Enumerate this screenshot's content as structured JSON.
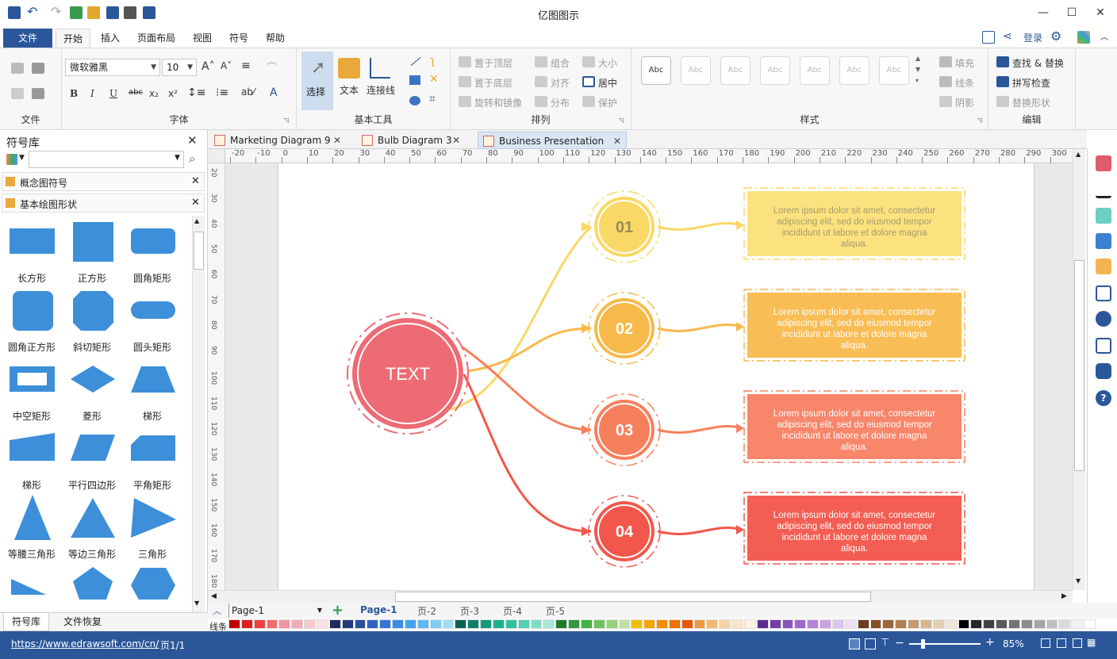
{
  "app": {
    "title": "亿图图示"
  },
  "window": {
    "minimize": "—",
    "restore": "☐",
    "close": "✕",
    "collapse": "︿",
    "help": "?"
  },
  "ribbon_tabs": [
    {
      "label": "文件"
    },
    {
      "label": "开始"
    },
    {
      "label": "插入"
    },
    {
      "label": "页面布局"
    },
    {
      "label": "视图"
    },
    {
      "label": "符号"
    },
    {
      "label": "帮助"
    }
  ],
  "account": {
    "login": "登录"
  },
  "ribbon": {
    "file_group": {
      "label": "文件"
    },
    "font_group": {
      "label": "字体",
      "font_name": "微软雅黑",
      "font_size": "10",
      "bold": "B",
      "italic": "I",
      "underline": "U",
      "strike": "abc",
      "sub": "x₂",
      "sup": "x²",
      "font_color": "A"
    },
    "tools_group": {
      "label": "基本工具",
      "select": "选择",
      "text": "文本",
      "connector": "连接线"
    },
    "arrange_group": {
      "label": "排列",
      "items": [
        "置于顶层",
        "组合",
        "大小",
        "置于底层",
        "对齐",
        "居中",
        "旋转和镜像",
        "分布",
        "保护"
      ]
    },
    "style_group": {
      "label": "样式",
      "swatch_text": "Abc",
      "fill": "填充",
      "line": "线条",
      "shadow": "阴影"
    },
    "edit_group": {
      "label": "编辑",
      "find": "查找 & 替换",
      "spell": "拼写检查",
      "replace_shape": "替换形状"
    }
  },
  "library": {
    "title": "符号库",
    "search_placeholder": "",
    "categories": [
      "概念图符号",
      "基本绘图形状"
    ],
    "shapes": [
      "长方形",
      "正方形",
      "圆角矩形",
      "圆角正方形",
      "斜切矩形",
      "圆头矩形",
      "中空矩形",
      "菱形",
      "梯形",
      "梯形",
      "平行四边形",
      "平角矩形",
      "等腰三角形",
      "等边三角形",
      "三角形"
    ],
    "bottom_tabs": [
      "符号库",
      "文件恢复"
    ]
  },
  "doc_tabs": [
    "Marketing Diagram 9",
    "Bulb Diagram 3",
    "Business Presentation"
  ],
  "ruler": {
    "h": [
      "-20",
      "-10",
      "0",
      "10",
      "20",
      "30",
      "40",
      "50",
      "60",
      "70",
      "80",
      "90",
      "100",
      "110",
      "120",
      "130",
      "140",
      "150",
      "160",
      "170",
      "180",
      "190",
      "200",
      "210",
      "220",
      "230",
      "240",
      "250",
      "260",
      "270",
      "280",
      "290",
      "300"
    ],
    "v": [
      "20",
      "30",
      "40",
      "50",
      "60",
      "70",
      "80",
      "90",
      "100",
      "110",
      "120",
      "130",
      "140",
      "150",
      "160",
      "170",
      "180"
    ]
  },
  "diagram": {
    "center_label": "TEXT",
    "items": [
      {
        "num": "01",
        "color": "#F9D866",
        "box_color": "#FCE27E",
        "text": "Lorem ipsum dolor sit amet, consectetur adipiscing elit, sed do eiusmod tempor incididunt ut labore et dolore magna aliqua."
      },
      {
        "num": "02",
        "color": "#F8B94B",
        "box_color": "#F9BD55",
        "text": "Lorem ipsum dolor sit amet, consectetur adipiscing elit, sed do eiusmod tempor incididunt ut labore et dolore magna aliqua."
      },
      {
        "num": "03",
        "color": "#F6805E",
        "box_color": "#F7866A",
        "text": "Lorem ipsum dolor sit amet, consectetur adipiscing elit, sed do eiusmod tempor incididunt ut labore et dolore magna aliqua."
      },
      {
        "num": "04",
        "color": "#F2574B",
        "box_color": "#F45D52",
        "text": "Lorem ipsum dolor sit amet, consectetur adipiscing elit, sed do eiusmod tempor incididunt ut labore et dolore magna aliqua."
      }
    ],
    "center_color": "#EC6B75"
  },
  "pages": {
    "current": "Page-1",
    "tabs": [
      "Page-1",
      "页-2",
      "页-3",
      "页-4",
      "页-5"
    ],
    "add": "+"
  },
  "colorbar": {
    "label": "线条",
    "colors": [
      "#c00000",
      "#e0201f",
      "#ef4040",
      "#f26b6b",
      "#f497a0",
      "#f2a9b8",
      "#f8c8d0",
      "#fbe0e6",
      "#1f2b5c",
      "#233a7e",
      "#2a4e9e",
      "#2f63c2",
      "#3476d8",
      "#3b8de6",
      "#47a3ee",
      "#5db9f2",
      "#7ccdf5",
      "#a2def8",
      "#0b5e55",
      "#0f7d6e",
      "#14997f",
      "#19b290",
      "#2ec39e",
      "#55d0b1",
      "#7fdcc5",
      "#a8e7d8",
      "#1e7b2a",
      "#2d9a37",
      "#45b046",
      "#6cc35c",
      "#93d27a",
      "#bde2a0",
      "#f0c000",
      "#f5a700",
      "#f28c00",
      "#ef7000",
      "#ea5600",
      "#f09a40",
      "#f5b870",
      "#f8d4a0",
      "#fbe6c8",
      "#fff2de",
      "#5c2d91",
      "#733ea6",
      "#8a52ba",
      "#a067cb",
      "#b584d8",
      "#c9a2e3",
      "#dcc3ee",
      "#ecdff6",
      "#6b3b20",
      "#84502c",
      "#9c6639",
      "#b37f50",
      "#c69a6e",
      "#d7b690",
      "#e5cfb1",
      "#f1e5d3",
      "#000000",
      "#262626",
      "#404040",
      "#595959",
      "#737373",
      "#8c8c8c",
      "#a6a6a6",
      "#bfbfbf",
      "#d9d9d9",
      "#f2f2f2",
      "#ffffff"
    ]
  },
  "status": {
    "url": "https://www.edrawsoft.com/cn/",
    "page": "页1/1",
    "zoom": "85%"
  }
}
